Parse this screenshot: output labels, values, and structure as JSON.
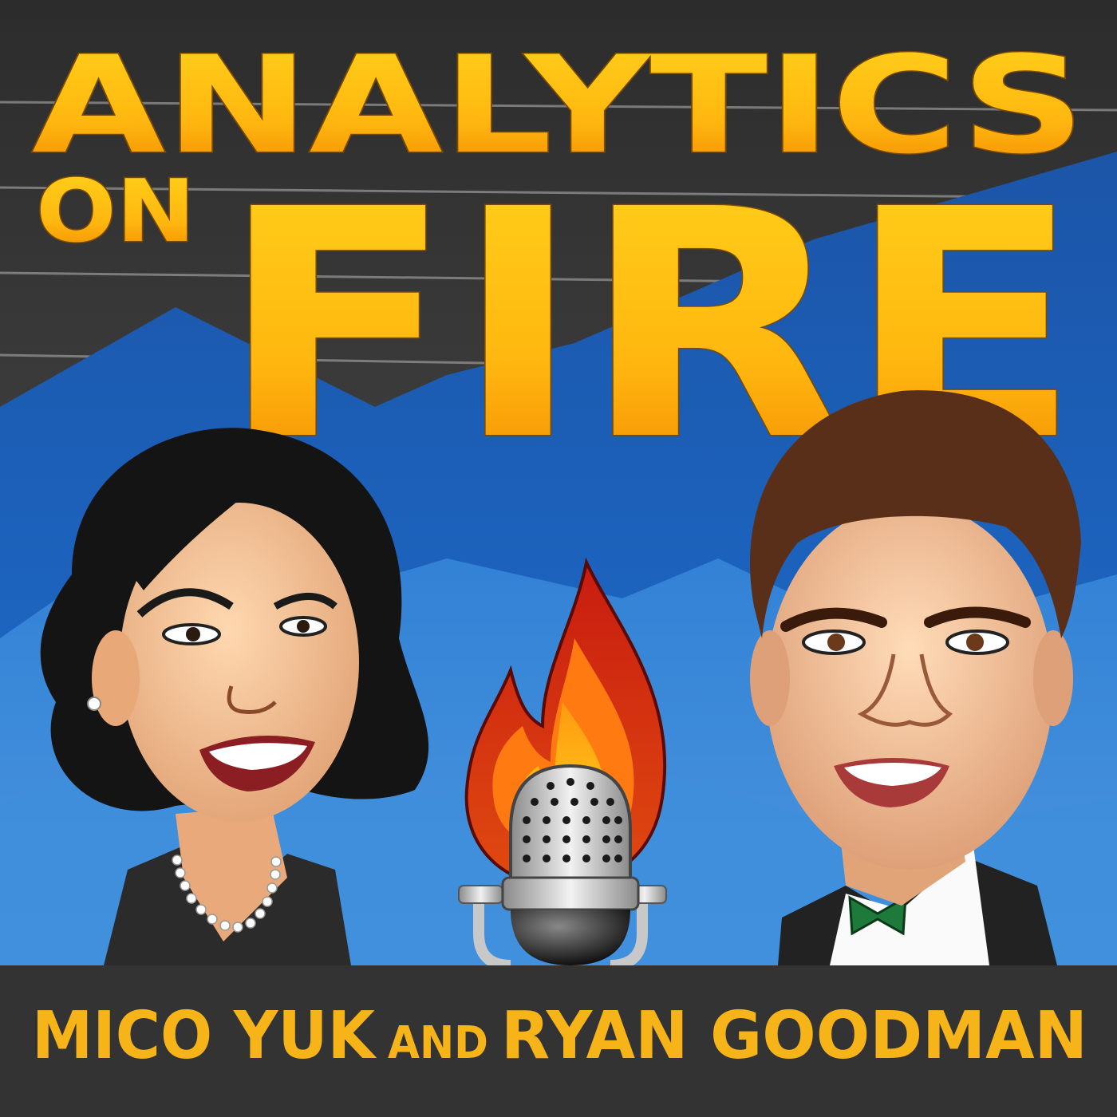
{
  "title": {
    "line1": "ANALYTICS",
    "line2_small": "ON",
    "line2_big": "FIRE"
  },
  "footer": {
    "host1": "MICO YUK",
    "conjunction": "AND",
    "host2": "RYAN GOODMAN"
  },
  "colors": {
    "background_dark": "#3a3a3a",
    "blue_mountain": "#1a5fb0",
    "blue_light": "#3d8ad8",
    "title_gold": "#ffc20e",
    "title_orange": "#f28a00",
    "footer_bar": "#333333",
    "footer_text": "#f6b418"
  },
  "icons": {
    "center": "microphone-with-flame-icon",
    "host1": "woman-caricature",
    "host2": "man-caricature"
  }
}
